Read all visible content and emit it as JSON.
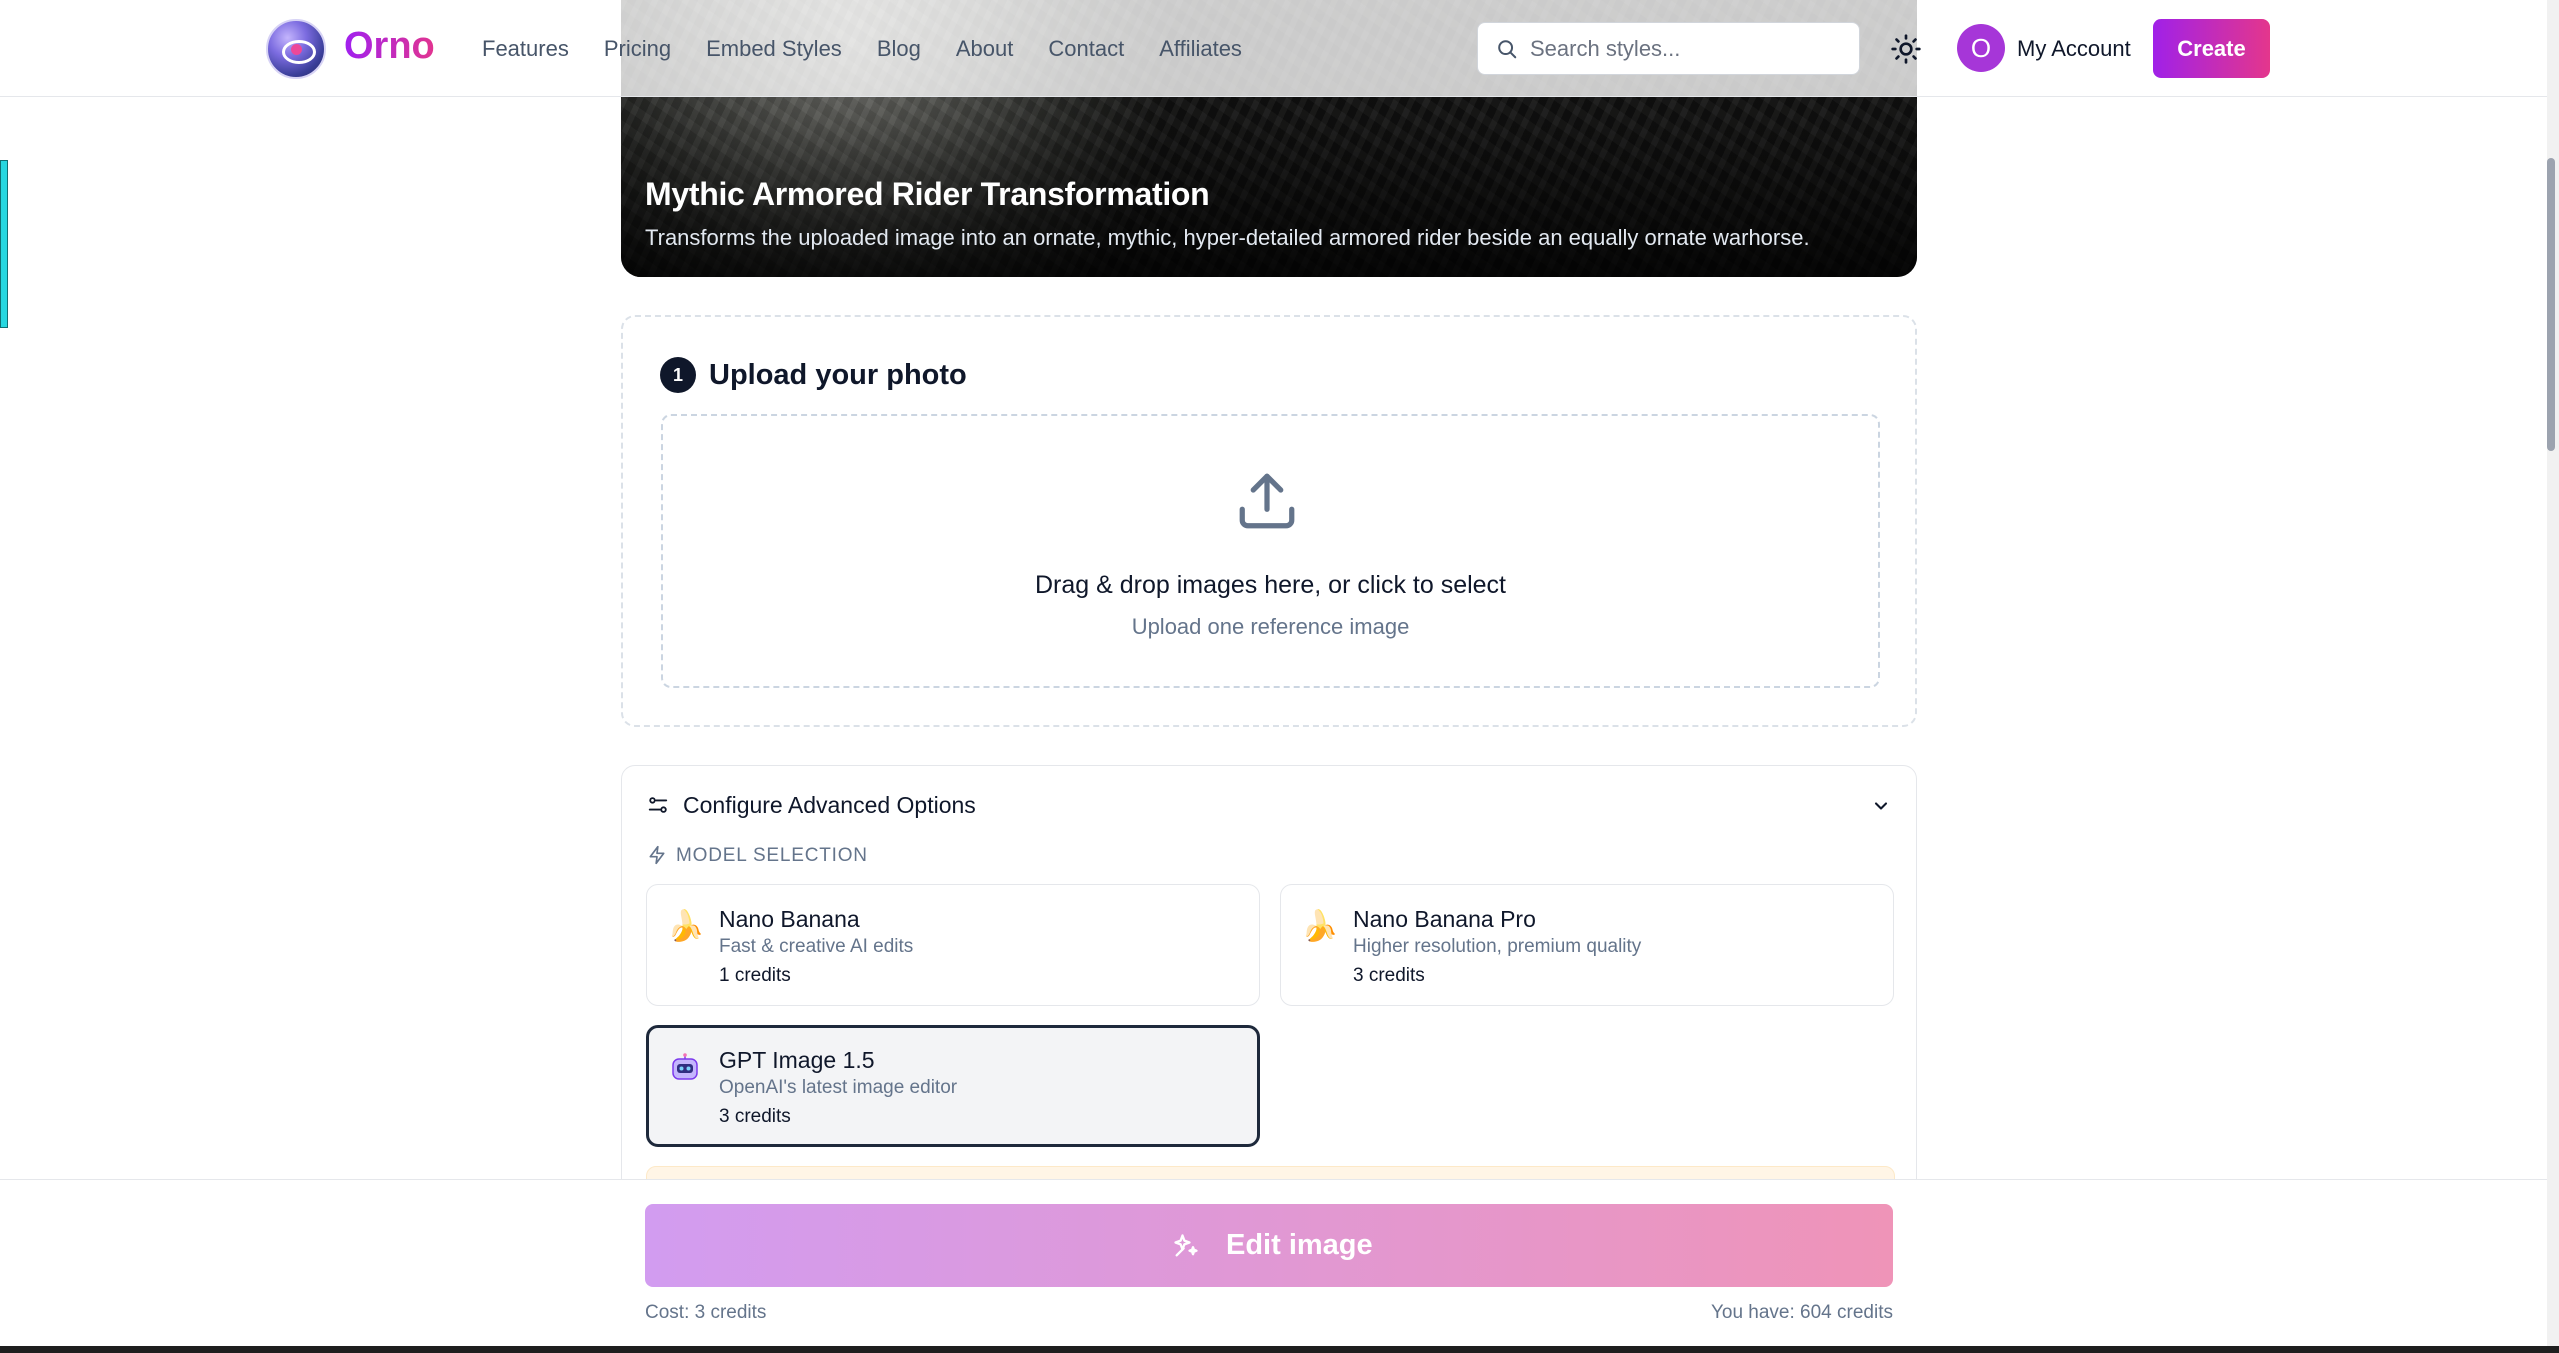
{
  "header": {
    "brand": "Orno",
    "nav": [
      "Features",
      "Pricing",
      "Embed Styles",
      "Blog",
      "About",
      "Contact",
      "Affiliates"
    ],
    "search_placeholder": "Search styles...",
    "avatar_initial": "O",
    "account_label": "My Account",
    "create_label": "Create"
  },
  "hero": {
    "title": "Mythic Armored Rider Transformation",
    "description": "Transforms the uploaded image into an ornate, mythic, hyper-detailed armored rider beside an equally ornate warhorse."
  },
  "upload": {
    "step": "1",
    "title": "Upload your photo",
    "drop_text": "Drag & drop images here, or click to select",
    "drop_sub": "Upload one reference image"
  },
  "advanced": {
    "title": "Configure Advanced Options",
    "model_selection_label": "MODEL SELECTION",
    "models": [
      {
        "name": "Nano Banana",
        "desc": "Fast & creative AI edits",
        "cost": "1 credits",
        "icon": "banana-icon",
        "selected": false
      },
      {
        "name": "Nano Banana Pro",
        "desc": "Higher resolution, premium quality",
        "cost": "3 credits",
        "icon": "banana-icon",
        "selected": false
      },
      {
        "name": "GPT Image 1.5",
        "desc": "OpenAI's latest image editor",
        "cost": "3 credits",
        "icon": "robot-icon",
        "selected": true
      }
    ]
  },
  "footer": {
    "edit_label": "Edit image",
    "cost": "Cost: 3 credits",
    "balance": "You have: 604 credits"
  },
  "colors": {
    "brand_gradient_start": "#a020f0",
    "brand_gradient_end": "#e2348f",
    "edit_button_start": "#d29cf0",
    "edit_button_end": "#ef94b8",
    "side_tab": "#26d7e0"
  }
}
